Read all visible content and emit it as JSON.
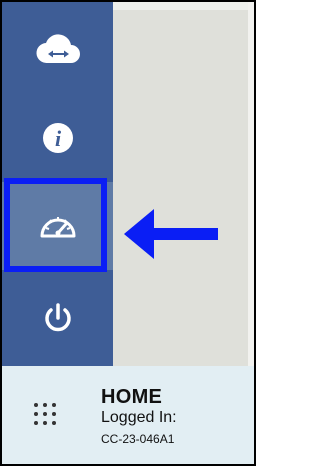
{
  "sidebar": {
    "items": [
      {
        "icon": "cloud-sync-icon",
        "active": false
      },
      {
        "icon": "info-icon",
        "active": false
      },
      {
        "icon": "speedometer-icon",
        "active": true
      },
      {
        "icon": "power-icon",
        "active": false
      }
    ]
  },
  "footer": {
    "menu_icon": "grid-menu-icon",
    "title": "HOME",
    "logged_in_label": "Logged In:",
    "device_id": "CC-23-046A1"
  },
  "annotation": {
    "color": "#0a1ef5",
    "arrow_icon": "left-arrow-icon"
  },
  "colors": {
    "sidebar": "#3e5d96",
    "sidebar_active": "#5f7ba6",
    "footer": "#e2eef3",
    "content": "#dfe0da"
  }
}
